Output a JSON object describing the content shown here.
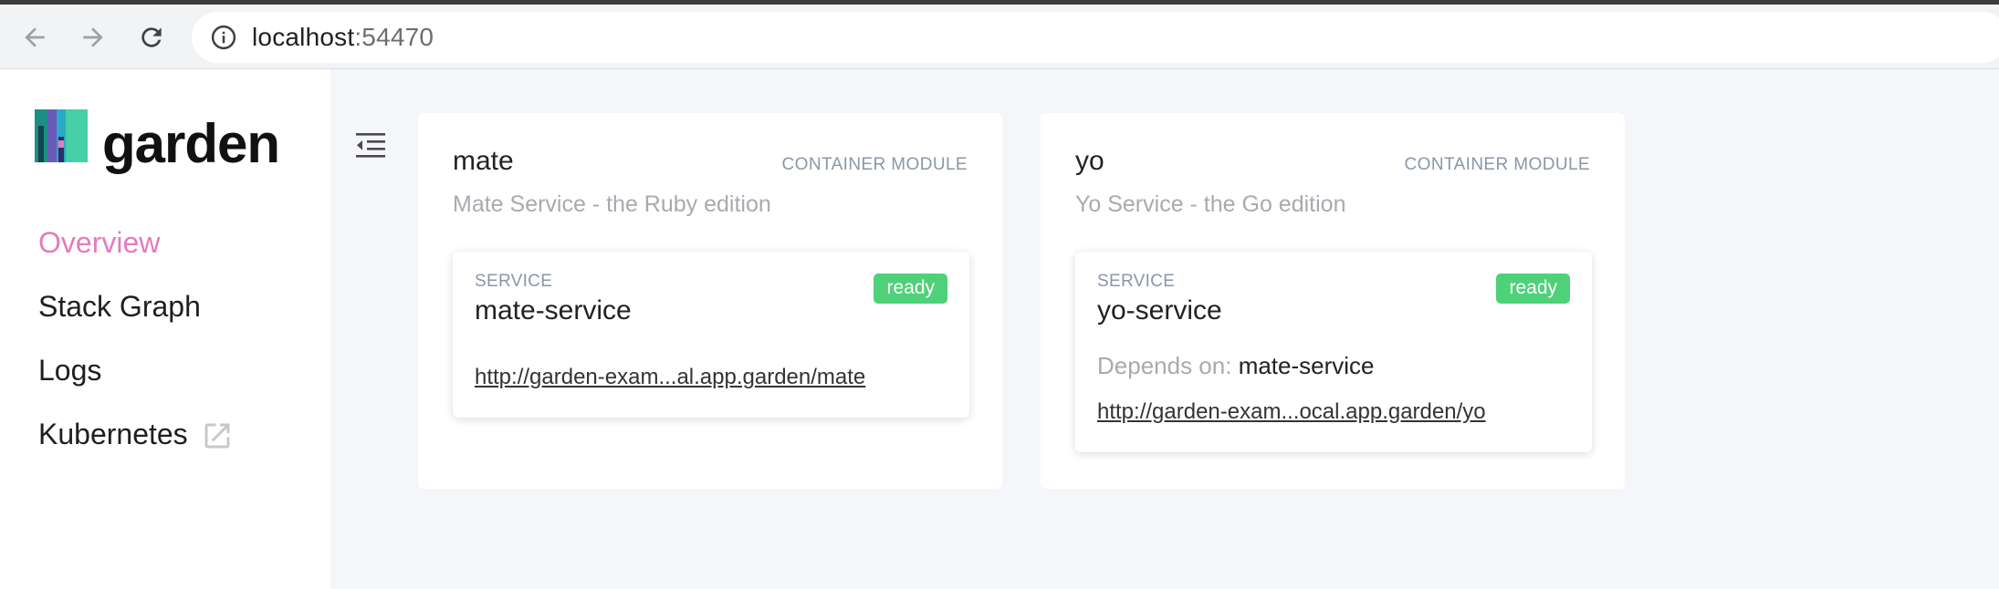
{
  "browser": {
    "url_host": "localhost",
    "url_port": ":54470"
  },
  "sidebar": {
    "logo_text": "garden",
    "items": [
      {
        "label": "Overview",
        "active": true
      },
      {
        "label": "Stack Graph",
        "active": false
      },
      {
        "label": "Logs",
        "active": false
      },
      {
        "label": "Kubernetes",
        "active": false,
        "external": true
      }
    ]
  },
  "modules": [
    {
      "name": "mate",
      "type": "CONTAINER MODULE",
      "description": "Mate Service - the Ruby edition",
      "service": {
        "label": "SERVICE",
        "name": "mate-service",
        "status": "ready",
        "link": "http://garden-exam...al.app.garden/mate"
      }
    },
    {
      "name": "yo",
      "type": "CONTAINER MODULE",
      "description": "Yo Service - the Go edition",
      "service": {
        "label": "SERVICE",
        "name": "yo-service",
        "status": "ready",
        "depends_label": "Depends on:",
        "depends_on": "mate-service",
        "link": "http://garden-exam...ocal.app.garden/yo"
      }
    }
  ],
  "colors": {
    "accent": "#e37bc0",
    "ready": "#4fd17a",
    "muted": "#8a96a8",
    "background": "#f5f6f9"
  },
  "icons": {
    "back": "arrow-left-icon",
    "forward": "arrow-right-icon",
    "reload": "reload-icon",
    "info": "info-icon",
    "collapse": "collapse-menu-icon",
    "external": "external-link-icon"
  }
}
